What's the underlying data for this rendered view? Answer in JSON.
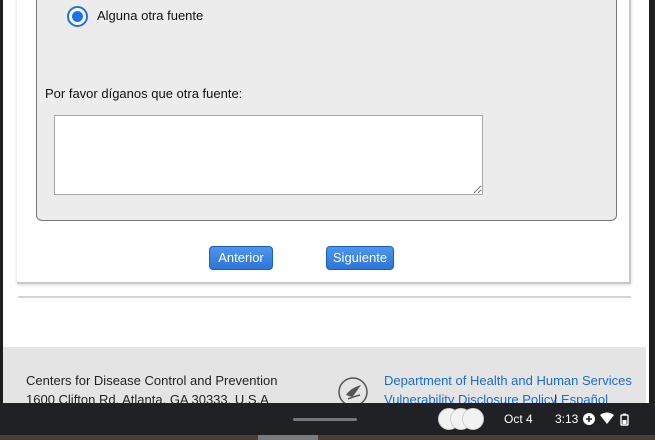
{
  "form": {
    "radio_option_label": "Alguna otra fuente",
    "radio_selected": true,
    "source_prompt": "Por favor díganos que otra fuente:",
    "source_value": "",
    "prev_button": "Anterior",
    "next_button": "Siguiente"
  },
  "footer": {
    "org_name": "Centers for Disease Control and Prevention",
    "org_address": "1600 Clifton Rd. Atlanta, GA 30333, U.S.A",
    "hhs_link": "Department of Health and Human Services",
    "vdp_link": "Vulnerability Disclosure Policy",
    "lang_separator": "|",
    "lang_link": "Español"
  },
  "shelf": {
    "date": "Oct 4",
    "time": "3:13",
    "icons": [
      "add-circle-icon",
      "wifi-icon",
      "battery-icon"
    ]
  },
  "colors": {
    "accent": "#1a73e8",
    "link": "#1a6dcc",
    "button": "#2f74d6"
  }
}
